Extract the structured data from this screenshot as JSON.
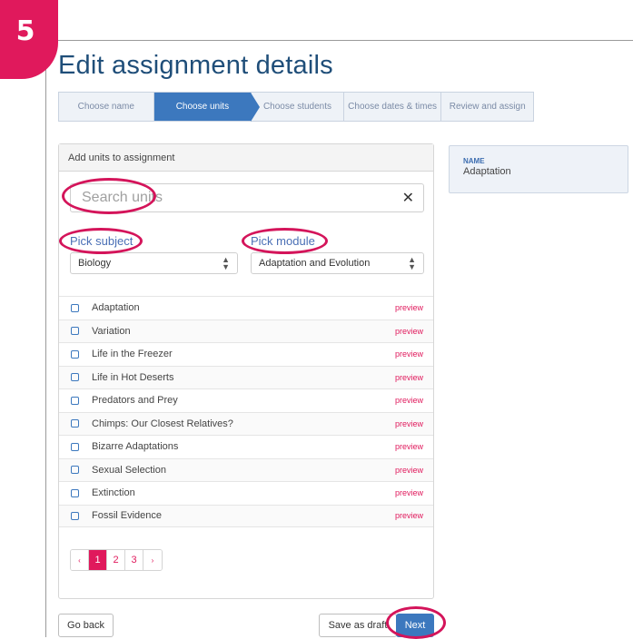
{
  "step_badge": "5",
  "page_title": "Edit assignment details",
  "wizard": {
    "steps": [
      "Choose name",
      "Choose units",
      "Choose students",
      "Choose dates & times",
      "Review and assign"
    ],
    "active_index": 1
  },
  "units_panel": {
    "header": "Add units to assignment",
    "search": {
      "placeholder": "Search units",
      "value": ""
    },
    "subject": {
      "label": "Pick subject",
      "selected": "Biology"
    },
    "module": {
      "label": "Pick module",
      "selected": "Adaptation and Evolution"
    },
    "preview_label": "preview",
    "units": [
      {
        "name": "Adaptation",
        "checked": false
      },
      {
        "name": "Variation",
        "checked": false
      },
      {
        "name": "Life in the Freezer",
        "checked": false
      },
      {
        "name": "Life in Hot Deserts",
        "checked": false
      },
      {
        "name": "Predators and Prey",
        "checked": false
      },
      {
        "name": "Chimps: Our Closest Relatives?",
        "checked": false
      },
      {
        "name": "Bizarre Adaptations",
        "checked": false
      },
      {
        "name": "Sexual Selection",
        "checked": false
      },
      {
        "name": "Extinction",
        "checked": false
      },
      {
        "name": "Fossil Evidence",
        "checked": false
      }
    ],
    "pagination": {
      "prev": "‹",
      "pages": [
        "1",
        "2",
        "3"
      ],
      "current": "1",
      "next": "›"
    }
  },
  "summary": {
    "label": "NAME",
    "value": "Adaptation"
  },
  "footer": {
    "back_label": "Go back",
    "draft_label": "Save as draft",
    "next_label": "Next"
  },
  "icons": {
    "clear": "close-icon",
    "select_arrows": "select-arrows-icon"
  },
  "colors": {
    "accent": "#e0195c",
    "primary": "#3c78be",
    "title": "#1f4e79",
    "highlight_ring": "#d4145a"
  }
}
